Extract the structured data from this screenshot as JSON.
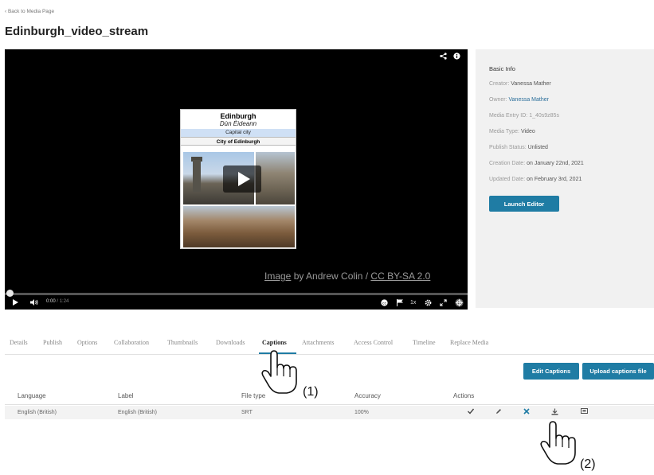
{
  "nav": {
    "back_label": "‹ Back to Media Page"
  },
  "page": {
    "title": "Edinburgh_video_stream"
  },
  "player": {
    "card_title": "Edinburgh",
    "card_subtitle": "Dùn Èideann",
    "card_caption": "Capital city",
    "card_city": "City of Edinburgh",
    "attribution_link1": "Image",
    "attribution_mid": " by Andrew Colin / ",
    "attribution_link2": "CC BY-SA 2.0",
    "time_current": "0:00",
    "time_total": " / 1:24",
    "speed_label": "1x",
    "progress_fraction": 0.0,
    "icons": [
      "share-icon",
      "info-icon",
      "play-icon",
      "volume-icon",
      "captions-icon",
      "flag-icon",
      "settings-icon",
      "fullscreen-icon",
      "kaltura-logo-icon"
    ]
  },
  "info": {
    "heading": "Basic Info",
    "creator_label": "Creator: ",
    "creator_value": "Vanessa Mather",
    "owner_label": "Owner: ",
    "owner_value": "Vanessa Mather",
    "entry_label": "Media Entry ID: ",
    "entry_value": "1_40s9z85s",
    "type_label": "Media Type: ",
    "type_value": "Video",
    "status_label": "Publish Status: ",
    "status_value": "Unlisted",
    "created_label": "Creation Date: ",
    "created_value": "on January 22nd, 2021",
    "updated_label": "Updated Date: ",
    "updated_value": "on February 3rd, 2021",
    "launch_label": "Launch Editor"
  },
  "tabs": [
    "Details",
    "Publish",
    "Options",
    "Collaboration",
    "Thumbnails",
    "Downloads",
    "Captions",
    "Attachments",
    "Access Control",
    "Timeline",
    "Replace Media"
  ],
  "active_tab": "Captions",
  "captions": {
    "edit_label": "Edit Captions",
    "upload_label": "Upload captions file",
    "headers": [
      "Language",
      "Label",
      "File type",
      "Accuracy",
      "Actions"
    ],
    "rows": [
      {
        "language": "English (British)",
        "label": "English (British)",
        "file_type": "SRT",
        "accuracy": "100%"
      }
    ],
    "row_action_icons": [
      "approve-check-icon",
      "edit-pencil-icon",
      "delete-x-icon",
      "download-icon",
      "preview-icon"
    ]
  },
  "annotations": {
    "callout1": "(1)",
    "callout2": "(2)"
  },
  "colors": {
    "accent": "#1f7ca4",
    "link": "#2a6e9a",
    "player_bg": "#000000",
    "panel_bg": "#f1f1f1"
  }
}
